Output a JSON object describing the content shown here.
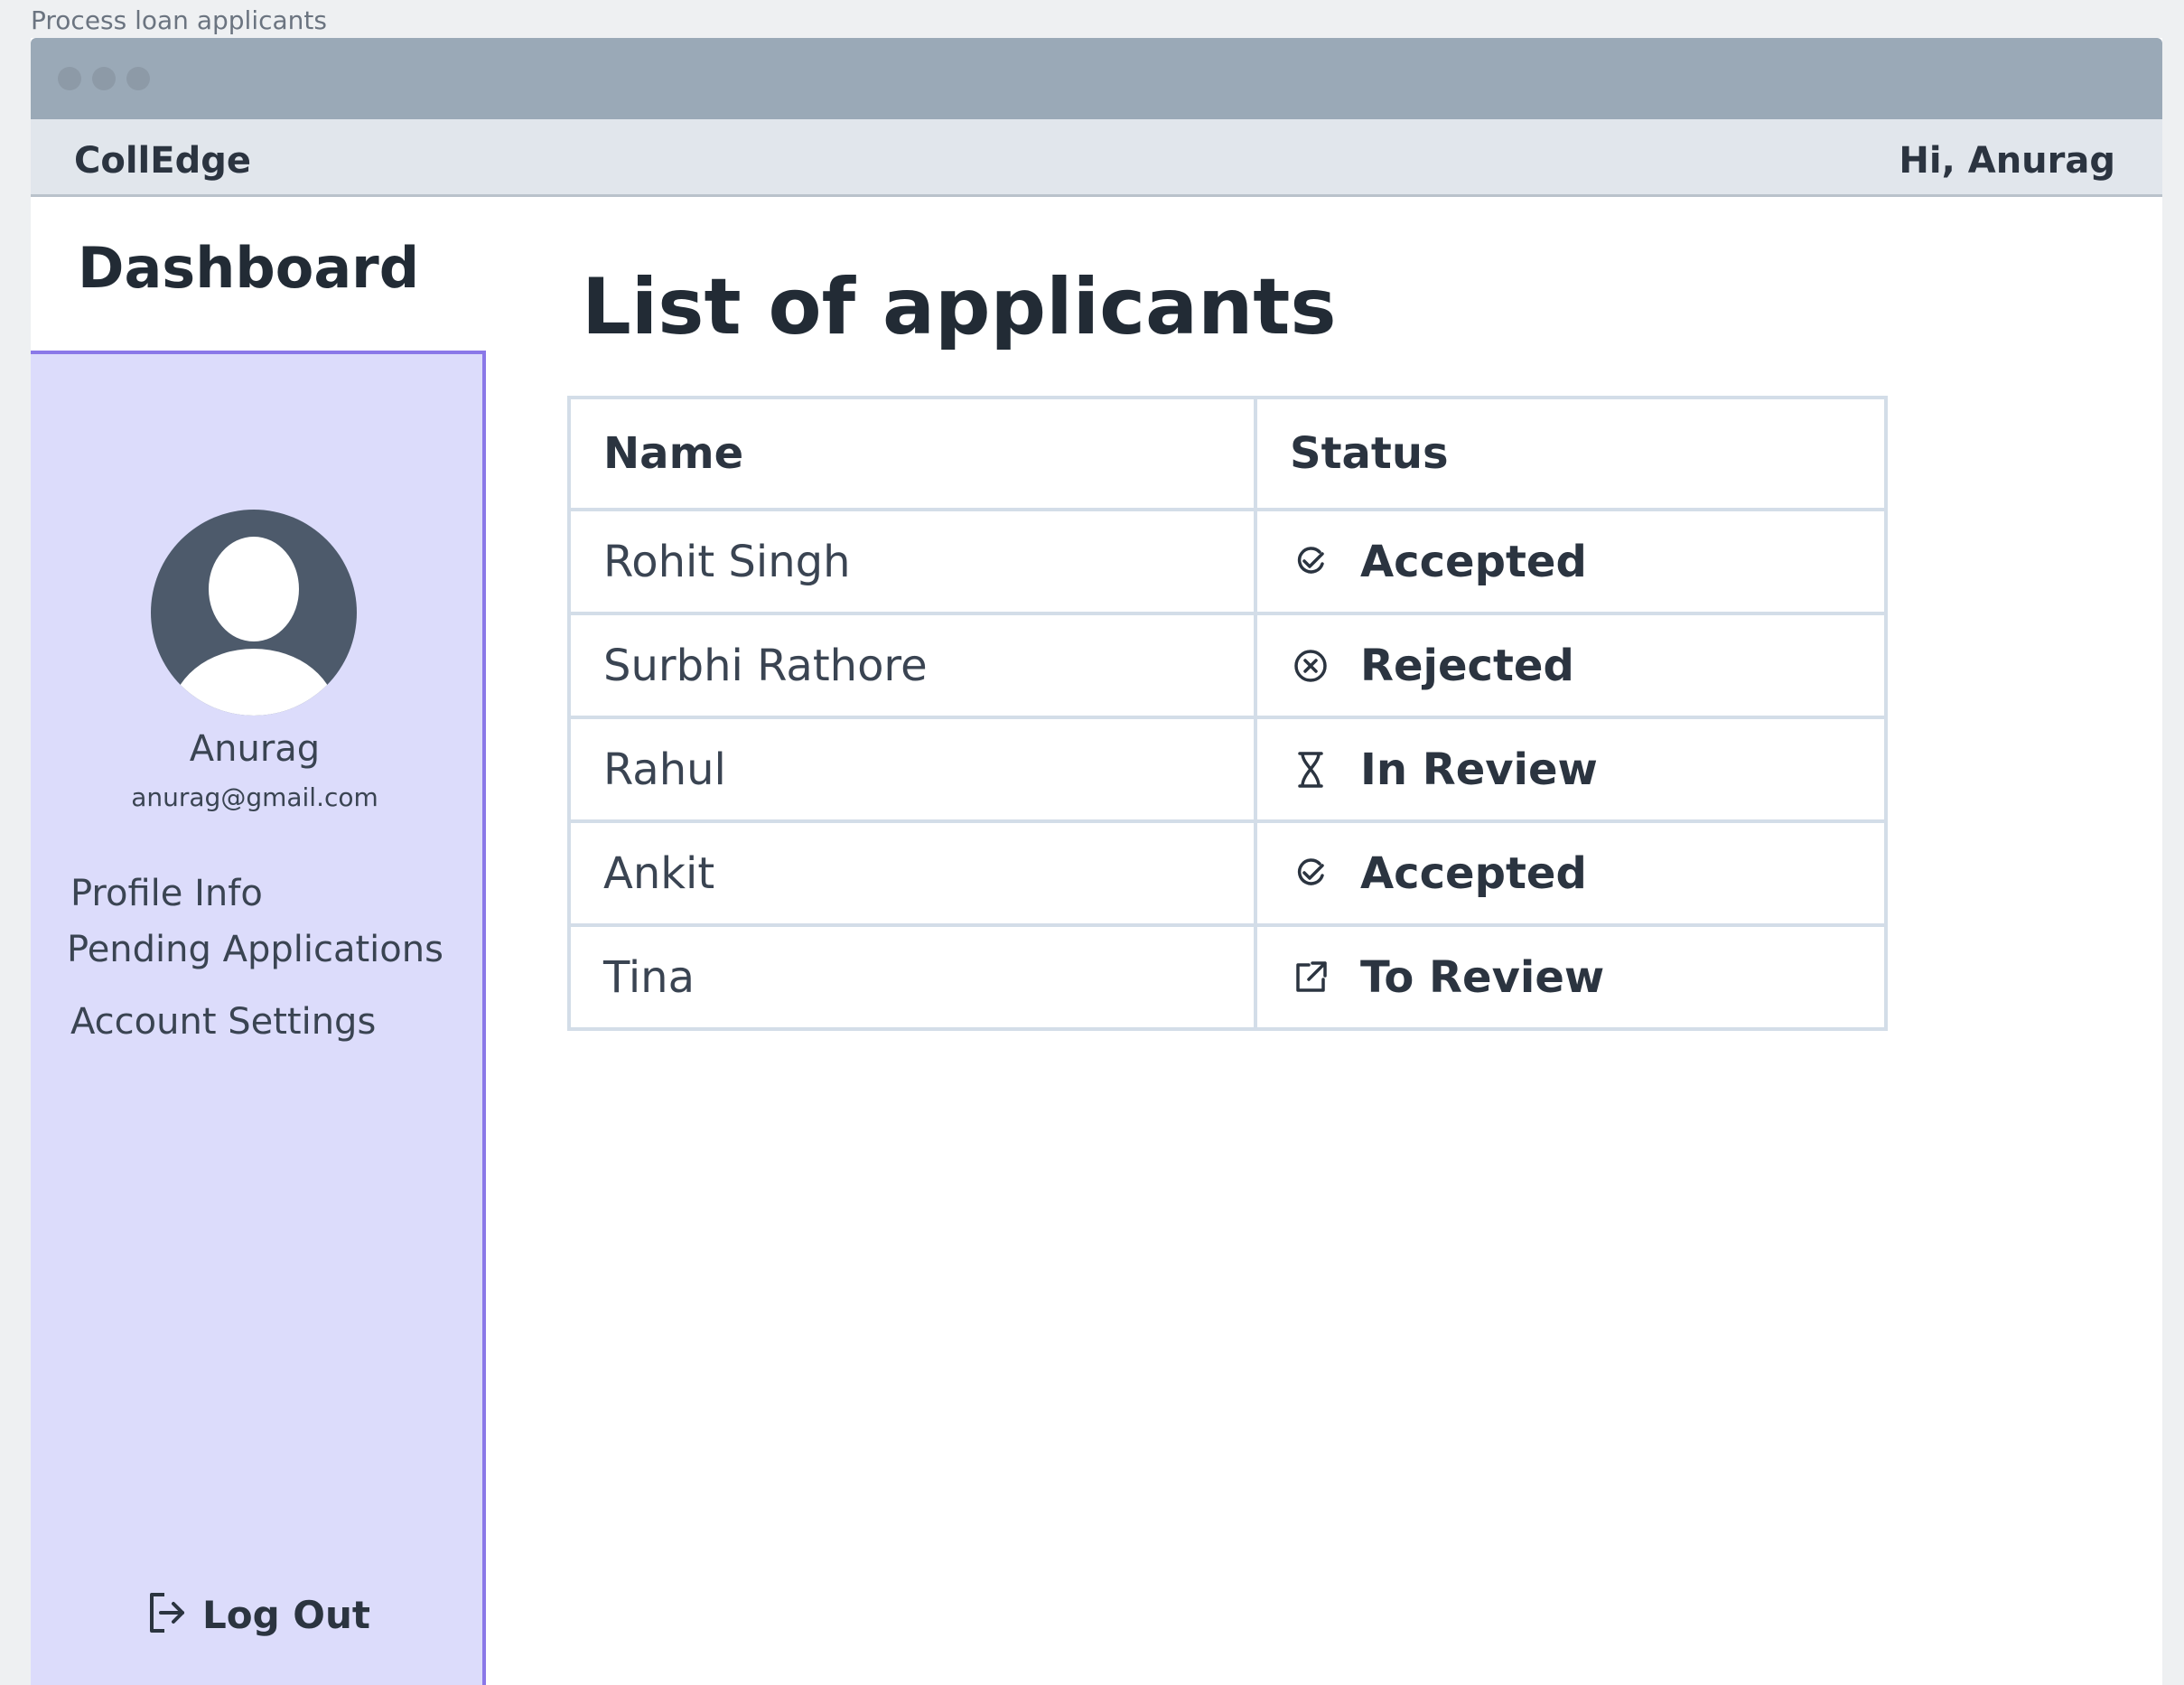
{
  "caption": "Process loan applicants",
  "app": {
    "brand": "CollEdge",
    "greeting": "Hi, Anurag"
  },
  "dashboard": {
    "title": "Dashboard"
  },
  "sidebar": {
    "user": {
      "name": "Anurag",
      "email": "anurag@gmail.com"
    },
    "menu": [
      {
        "label": "Profile Info"
      },
      {
        "label": "Pending Applications"
      },
      {
        "label": "Account Settings"
      }
    ],
    "logout": {
      "label": "Log Out",
      "icon": "logout-icon"
    }
  },
  "main": {
    "title": "List of applicants",
    "columns": [
      "Name",
      "Status"
    ],
    "rows": [
      {
        "name": "Rohit Singh",
        "status": "Accepted",
        "icon": "check-circle-icon"
      },
      {
        "name": "Surbhi Rathore",
        "status": "Rejected",
        "icon": "x-circle-icon"
      },
      {
        "name": "Rahul",
        "status": "In Review",
        "icon": "hourglass-icon"
      },
      {
        "name": "Ankit",
        "status": "Accepted",
        "icon": "check-circle-icon"
      },
      {
        "name": "Tina",
        "status": "To Review",
        "icon": "external-link-icon"
      }
    ]
  },
  "colors": {
    "titlebar": "#9aa9b7",
    "appbar": "#e1e6ec",
    "sidebar_bg": "#dcdcfb",
    "sidebar_border": "#8a78e8",
    "table_border": "#d3dde8",
    "text": "#2b3440"
  }
}
